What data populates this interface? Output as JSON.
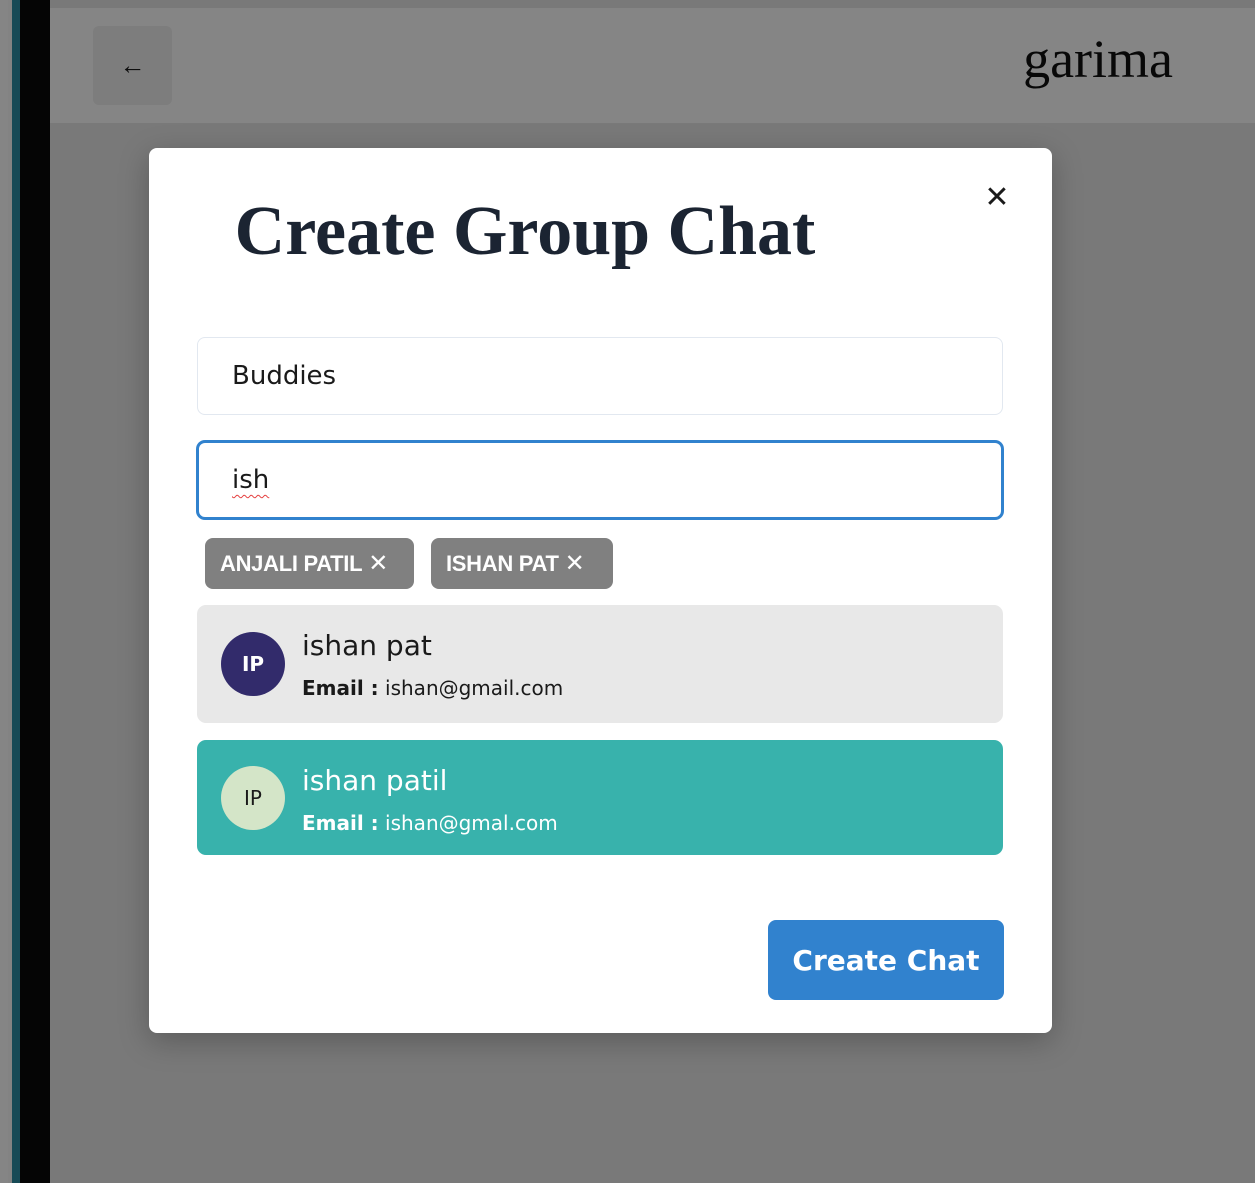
{
  "header": {
    "back_icon": "arrow-left-icon",
    "chat_name": "garima"
  },
  "modal": {
    "title": "Create Group Chat",
    "close_icon": "close-icon",
    "group_name_input": {
      "value": "Buddies"
    },
    "search_input": {
      "value": "ish"
    },
    "selected_users": [
      {
        "label": "ANJALI PATIL",
        "remove_icon": "close-icon"
      },
      {
        "label": "ISHAN PAT",
        "remove_icon": "close-icon"
      }
    ],
    "search_results": [
      {
        "initials": "IP",
        "name": "ishan pat",
        "email_label": "Email :",
        "email": "ishan@gmail.com"
      },
      {
        "initials": "IP",
        "name": "ishan patil",
        "email_label": "Email :",
        "email": "ishan@gmal.com"
      }
    ],
    "create_button_label": "Create Chat"
  },
  "colors": {
    "accent_blue": "#3182ce",
    "teal_highlight": "#38b2ac",
    "chip_gray": "#808080",
    "avatar_purple": "#322b6b",
    "avatar_green": "#d4e5c8"
  }
}
